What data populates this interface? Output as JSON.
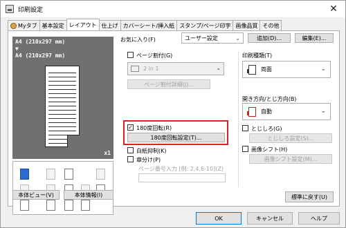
{
  "window": {
    "title": "印刷設定",
    "close_glyph": "✕"
  },
  "tabs": [
    "Myタブ",
    "基本設定",
    "レイアウト",
    "仕上げ",
    "カバーシート/挿入紙",
    "スタンプ/ページ印字",
    "画像品質",
    "その他"
  ],
  "preview": {
    "line1": "A4 (210x297 mm)",
    "arrow": "▼",
    "line2": "A4 (210x297 mm)",
    "copies": "x1"
  },
  "left_buttons": {
    "view": "本体ビュー(V)",
    "info": "本体情報(I)"
  },
  "favorites": {
    "label": "お気に入り(F)",
    "value": "ユーザー設定",
    "add": "追加(D)...",
    "edit": "編集(E)..."
  },
  "combination": {
    "label": "ページ割付(G)",
    "value": "2 in 1",
    "details": "ページ割付詳細(J)..."
  },
  "rotate": {
    "label": "180度回転(R)",
    "details": "180度回転設定(T)...",
    "checked": "✓"
  },
  "blank": {
    "label": "白紙抑制(K)"
  },
  "chapter": {
    "label": "章分け(P)",
    "input_label": "ページ番号入力 [例: 2,4,6-10](Z)"
  },
  "print_type": {
    "label": "印刷種類(T)",
    "value": "両面"
  },
  "binding": {
    "label": "開き方向/とじ方向(B)",
    "value": "自動"
  },
  "margin": {
    "label": "とじしろ(G)",
    "button": "とじしろ設定(S)..."
  },
  "shift": {
    "label": "画像シフト(H)",
    "button": "画像シフト設定(M)..."
  },
  "defaults": {
    "label": "標準に戻す(U)"
  },
  "footer": {
    "ok": "OK",
    "cancel": "キャンセル",
    "help": "ヘルプ"
  },
  "colors": {
    "highlight": "#e02020",
    "preview_bg": "#707070",
    "ok_border": "#0078d7"
  }
}
